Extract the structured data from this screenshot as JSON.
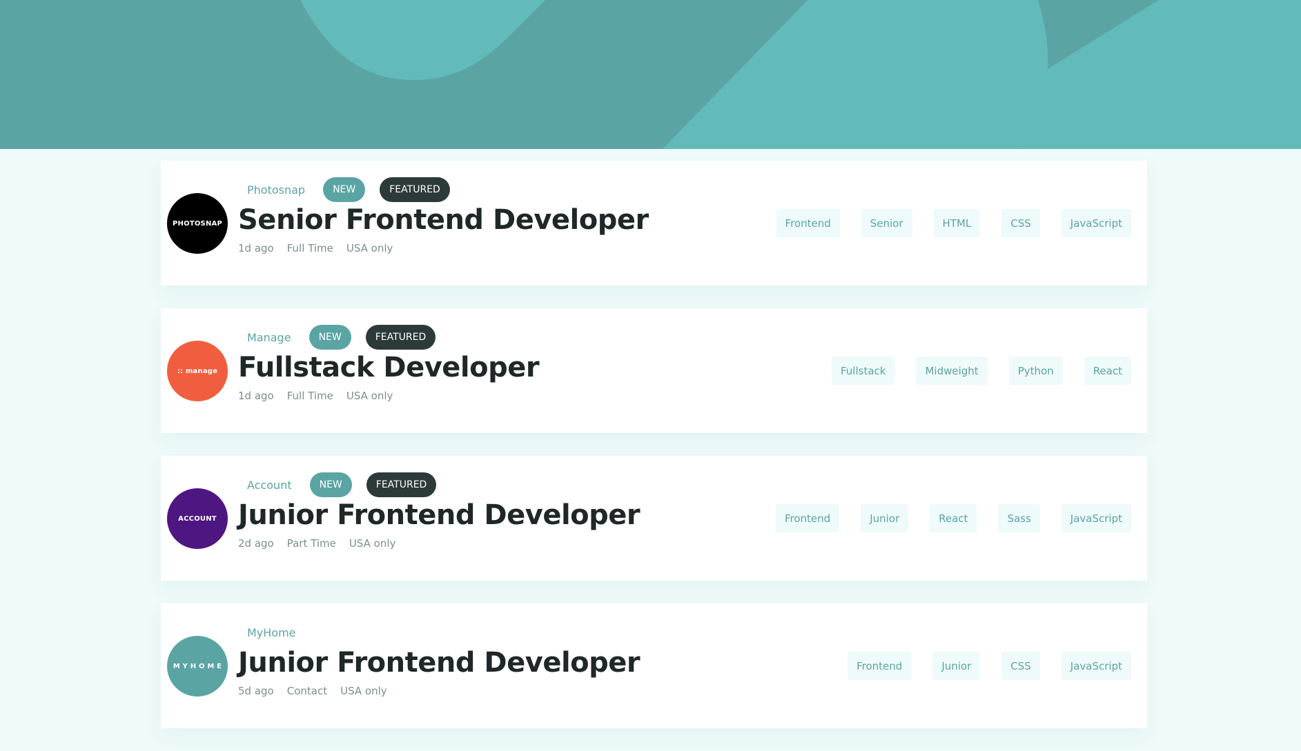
{
  "colors": {
    "header_bg": "#5ba4a4",
    "header_shape": "#63baba",
    "page_bg": "#effafa",
    "accent": "#5ba4a4",
    "dark": "#2c3a3a"
  },
  "jobs": [
    {
      "company": "Photosnap",
      "logo_text": "PHOTOSNAP",
      "logo_color": "#000000",
      "new_label": "NEW",
      "featured_label": "FEATURED",
      "title": "Senior Frontend Developer",
      "posted": "1d ago",
      "contract": "Full Time",
      "location": "USA only",
      "tags": [
        "Frontend",
        "Senior",
        "HTML",
        "CSS",
        "JavaScript"
      ]
    },
    {
      "company": "Manage",
      "logo_text": ":: manage",
      "logo_color": "#f15e3f",
      "new_label": "NEW",
      "featured_label": "FEATURED",
      "title": "Fullstack Developer",
      "posted": "1d ago",
      "contract": "Full Time",
      "location": "USA only",
      "tags": [
        "Fullstack",
        "Midweight",
        "Python",
        "React"
      ]
    },
    {
      "company": "Account",
      "logo_text": "ACCOUNT",
      "logo_color": "#4e1681",
      "new_label": "NEW",
      "featured_label": "FEATURED",
      "title": "Junior Frontend Developer",
      "posted": "2d ago",
      "contract": "Part Time",
      "location": "USA only",
      "tags": [
        "Frontend",
        "Junior",
        "React",
        "Sass",
        "JavaScript"
      ]
    },
    {
      "company": "MyHome",
      "logo_text": "M Y H O M E",
      "logo_color": "#5ba4a4",
      "title": "Junior Frontend Developer",
      "posted": "5d ago",
      "contract": "Contact",
      "location": "USA only",
      "tags": [
        "Frontend",
        "Junior",
        "CSS",
        "JavaScript"
      ]
    }
  ]
}
